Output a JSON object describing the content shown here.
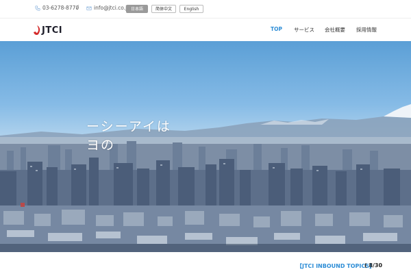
{
  "topbar": {
    "phone": "03-6278-8770",
    "separator": "/",
    "email": "info@jtci.co.jp",
    "languages": [
      {
        "label": "日本語",
        "active": true
      },
      {
        "label": "简体中文",
        "active": false
      },
      {
        "label": "English",
        "active": false
      }
    ]
  },
  "header": {
    "logo_text": "JTCI",
    "nav": [
      {
        "label": "TOP",
        "active": true
      },
      {
        "label": "サービス",
        "active": false
      },
      {
        "label": "会社概要",
        "active": false
      },
      {
        "label": "採用情報",
        "active": false
      }
    ]
  },
  "hero": {
    "line1": "ーシーアイは",
    "line2": "ヨの"
  },
  "topics": {
    "tag": "【JTCI INBOUND TOPICS】",
    "date": "( 8/30"
  },
  "colors": {
    "accent": "#2d8dd6",
    "logo_red": "#d42a2a",
    "active_lang_bg": "#9a9a9a"
  },
  "icons": [
    "phone-icon",
    "mail-icon"
  ]
}
